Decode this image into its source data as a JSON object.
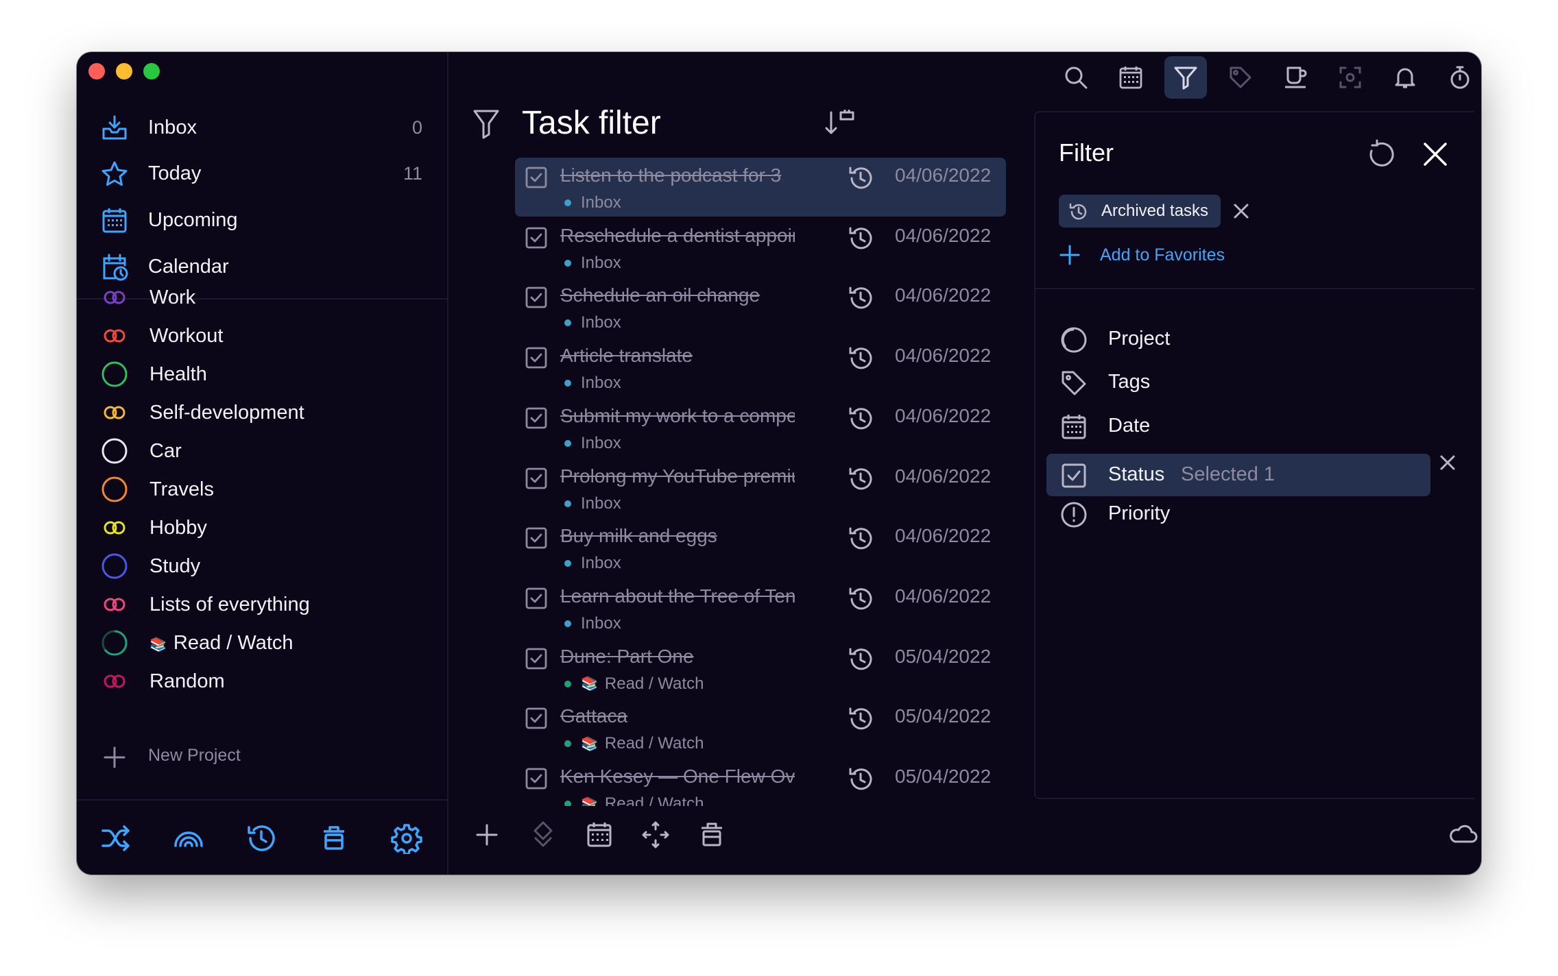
{
  "sidebar": {
    "nav": [
      {
        "label": "Inbox",
        "count": "0"
      },
      {
        "label": "Today",
        "count": "11"
      },
      {
        "label": "Upcoming",
        "count": ""
      },
      {
        "label": "Calendar",
        "count": ""
      }
    ],
    "projects": [
      {
        "label": "Work",
        "color": "#7b3fc4",
        "shape": "rings"
      },
      {
        "label": "Workout",
        "color": "#f04a3c",
        "shape": "rings"
      },
      {
        "label": "Health",
        "color": "#2fbf5f",
        "shape": "ring"
      },
      {
        "label": "Self-development",
        "color": "#f5b82e",
        "shape": "rings"
      },
      {
        "label": "Car",
        "color": "#e8e8ee",
        "shape": "ring"
      },
      {
        "label": "Travels",
        "color": "#f5872e",
        "shape": "ring"
      },
      {
        "label": "Hobby",
        "color": "#e6e61e",
        "shape": "rings"
      },
      {
        "label": "Study",
        "color": "#4d56e8",
        "shape": "ring"
      },
      {
        "label": "Lists of everything",
        "color": "#f0467a",
        "shape": "rings"
      },
      {
        "label": "Read / Watch",
        "color": "#1fa27a",
        "shape": "progress"
      },
      {
        "label": "Random",
        "color": "#c2185b",
        "shape": "rings"
      }
    ],
    "new_project": "New Project"
  },
  "main": {
    "title": "Task filter",
    "tasks": [
      {
        "name": "Listen to the podcast for 3",
        "project": "Inbox",
        "date": "04/06/2022",
        "selected": true
      },
      {
        "name": "Reschedule a dentist appointment",
        "project": "Inbox",
        "date": "04/06/2022"
      },
      {
        "name": "Schedule an oil change",
        "project": "Inbox",
        "date": "04/06/2022"
      },
      {
        "name": "Article translate",
        "project": "Inbox",
        "date": "04/06/2022"
      },
      {
        "name": "Submit my work to a competition",
        "project": "Inbox",
        "date": "04/06/2022"
      },
      {
        "name": "Prolong my YouTube premium",
        "project": "Inbox",
        "date": "04/06/2022"
      },
      {
        "name": "Buy milk and eggs",
        "project": "Inbox",
        "date": "04/06/2022"
      },
      {
        "name": "Learn about the Tree of Tenere",
        "project": "Inbox",
        "date": "04/06/2022"
      },
      {
        "name": "Dune: Part One",
        "project": "Read / Watch",
        "date": "05/04/2022"
      },
      {
        "name": "Gattaca",
        "project": "Read / Watch",
        "date": "05/04/2022"
      },
      {
        "name": "Ken Kesey — One Flew Over",
        "project": "Read / Watch",
        "date": "05/04/2022"
      }
    ]
  },
  "filter": {
    "title": "Filter",
    "chip": "Archived tasks",
    "add_favorites": "Add to Favorites",
    "items": [
      {
        "label": "Project",
        "sub": ""
      },
      {
        "label": "Tags",
        "sub": ""
      },
      {
        "label": "Date",
        "sub": ""
      },
      {
        "label": "Status",
        "sub": "Selected 1"
      },
      {
        "label": "Priority",
        "sub": ""
      }
    ]
  },
  "colors": {
    "accent": "#3ea6ff",
    "selection": "#25304e",
    "background": "#0b0618"
  }
}
